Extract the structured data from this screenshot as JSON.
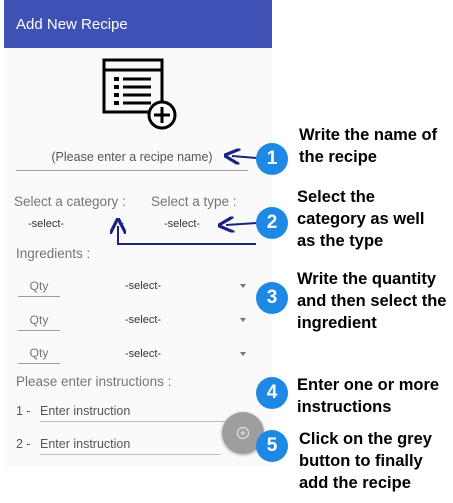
{
  "appbar": {
    "title": "Add New Recipe"
  },
  "recipe_name": {
    "placeholder": "(Please enter a recipe name)"
  },
  "category": {
    "label": "Select a category :",
    "value": "-select-"
  },
  "type": {
    "label": "Select a type :",
    "value": "-select-"
  },
  "ingredients": {
    "label": "Ingredients :",
    "rows": [
      {
        "qty_placeholder": "Qty",
        "ingredient": "-select-"
      },
      {
        "qty_placeholder": "Qty",
        "ingredient": "-select-"
      },
      {
        "qty_placeholder": "Qty",
        "ingredient": "-select-"
      }
    ]
  },
  "instructions": {
    "label": "Please enter instructions :",
    "items": [
      {
        "num": "1 -",
        "placeholder": "Enter instruction"
      },
      {
        "num": "2 -",
        "placeholder": "Enter instruction"
      }
    ]
  },
  "fab": {
    "icon": "add-circle-icon",
    "color": "#9e9e9e"
  },
  "annotations": [
    {
      "num": "1",
      "text": "Write the name of the recipe"
    },
    {
      "num": "2",
      "text": "Select the category as well as the type"
    },
    {
      "num": "3",
      "text": "Write the quantity and then select the ingredient"
    },
    {
      "num": "4",
      "text": "Enter one or more instructions"
    },
    {
      "num": "5",
      "text": "Click on the grey button to finally add the recipe"
    }
  ],
  "colors": {
    "appbar": "#3f51b5",
    "badge": "#1e88e5",
    "annotation_arrow": "#1a237e"
  }
}
